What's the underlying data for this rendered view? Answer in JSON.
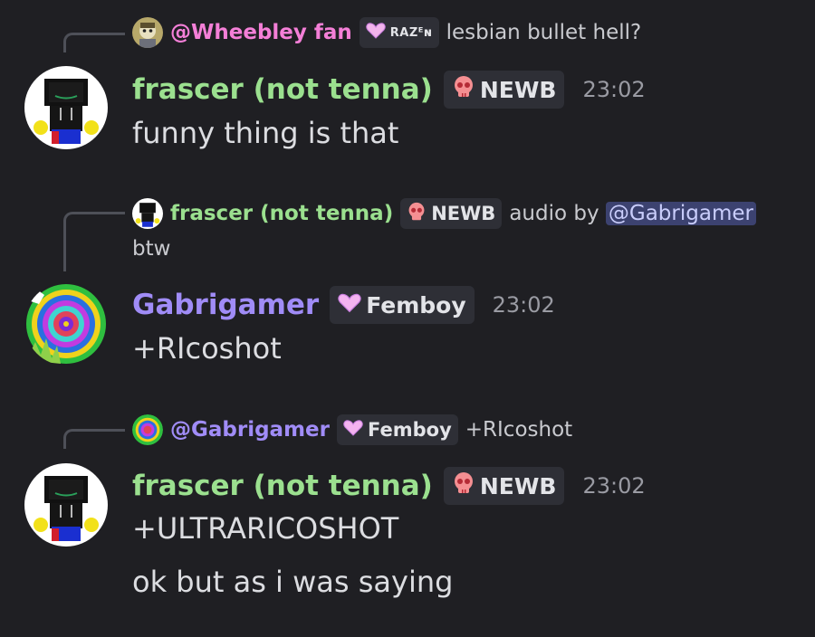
{
  "messages": [
    {
      "reply": {
        "author": "@Wheebley fan",
        "badge": "RAZᴱɴ",
        "text": "lesbian bullet hell?"
      },
      "author": "frascer (not tenna)",
      "badge": "NEWB",
      "time": "23:02",
      "lines": [
        "funny thing is that"
      ]
    },
    {
      "reply": {
        "author": "frascer (not tenna)",
        "badge": "NEWB",
        "text": "audio by",
        "mention": "@Gabrigamer",
        "continuation": "btw"
      },
      "author": "Gabrigamer",
      "badge": "Femboy",
      "time": "23:02",
      "lines": [
        "+RIcoshot"
      ]
    },
    {
      "reply": {
        "author": "@Gabrigamer",
        "badge": "Femboy",
        "text": "+RIcoshot"
      },
      "author": "frascer (not tenna)",
      "badge": "NEWB",
      "time": "23:02",
      "lines": [
        "+ULTRARICOSHOT",
        "ok but as i was saying"
      ]
    }
  ],
  "colors": {
    "background": "#1f1f23",
    "frascer_name": "#9be08f",
    "wheebley_name": "#f47fd7",
    "gabrigamer_name": "#a08cf7",
    "mention_bg": "#3c4270",
    "timestamp": "#9a9ba3"
  },
  "icons": {
    "newb_badge": "pink-skull-icon",
    "femboy_badge": "pink-heart-icon",
    "raz_badge": "pink-heart-icon"
  }
}
